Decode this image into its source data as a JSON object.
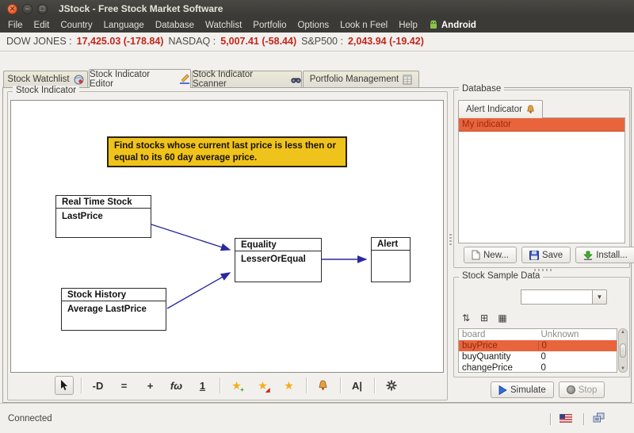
{
  "window": {
    "title": "JStock - Free Stock Market Software"
  },
  "menu": {
    "items": [
      "File",
      "Edit",
      "Country",
      "Language",
      "Database",
      "Watchlist",
      "Portfolio",
      "Options",
      "Look n Feel",
      "Help"
    ],
    "android": "Android"
  },
  "ticker": [
    {
      "label": "DOW JONES :",
      "value": "17,425.03 (-178.84)"
    },
    {
      "label": "NASDAQ :",
      "value": "5,007.41 (-58.44)"
    },
    {
      "label": "S&P500 :",
      "value": "2,043.94 (-19.42)"
    }
  ],
  "tabs": [
    {
      "label": "Stock Watchlist"
    },
    {
      "label": "Stock Indicator Editor"
    },
    {
      "label": "Stock Indicator Scanner"
    },
    {
      "label": "Portfolio Management"
    }
  ],
  "editor": {
    "title": "Stock Indicator",
    "note": "Find stocks whose current last price is less then or equal to its 60 day average price.",
    "nodes": {
      "realtime": {
        "title": "Real Time Stock",
        "field": "LastPrice"
      },
      "history": {
        "title": "Stock History",
        "field": "Average LastPrice"
      },
      "equality": {
        "title": "Equality",
        "field": "LesserOrEqual"
      },
      "alert": {
        "title": "Alert"
      }
    },
    "toolbar": {
      "operator": "-D",
      "equality": "=",
      "arithmetic": "+",
      "function": "fω",
      "constant": "1",
      "label": "A|"
    }
  },
  "database": {
    "title": "Database",
    "tab": "Alert Indicator",
    "selected_item": "My indicator",
    "new": "New...",
    "save": "Save",
    "install": "Install..."
  },
  "sample": {
    "title": "Stock Sample Data",
    "combo_value": "",
    "rows": [
      [
        "board",
        "Unknown"
      ],
      [
        "buyPrice",
        "0"
      ],
      [
        "buyQuantity",
        "0"
      ],
      [
        "changePrice",
        "0"
      ]
    ],
    "simulate": "Simulate",
    "stop": "Stop"
  },
  "status": {
    "text": "Connected"
  },
  "colors": {
    "selection_orange": "#e8643c",
    "ticker_red": "#c3261c",
    "note_yellow": "#f0c31c",
    "arrow_navy": "#2a29a0",
    "android_green": "#8bc34a"
  }
}
